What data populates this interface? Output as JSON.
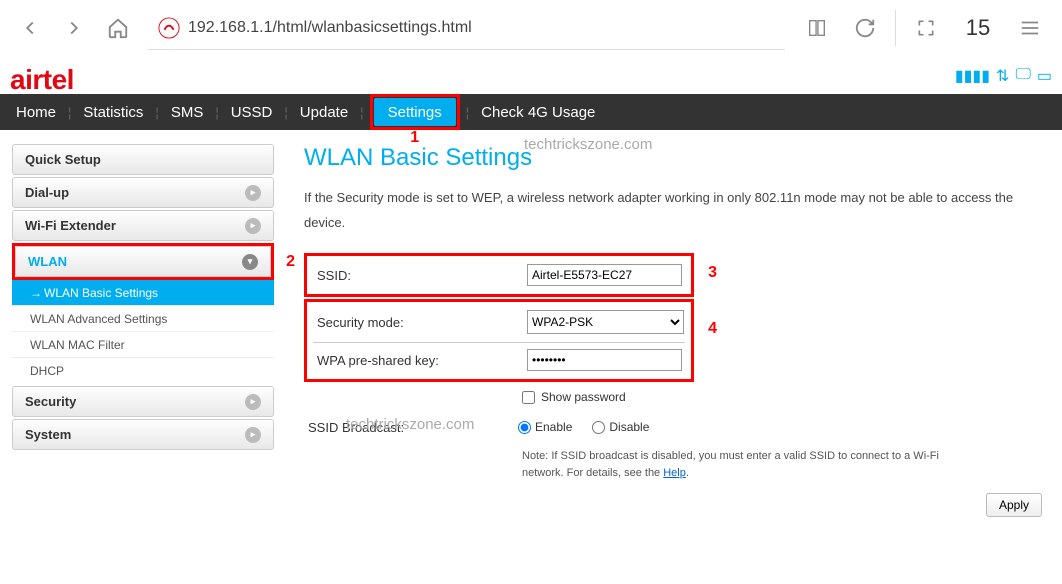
{
  "browser": {
    "url": "192.168.1.1/html/wlanbasicsettings.html",
    "tabs_count": "15"
  },
  "logo": "airtel",
  "nav": {
    "home": "Home",
    "statistics": "Statistics",
    "sms": "SMS",
    "ussd": "USSD",
    "update": "Update",
    "settings": "Settings",
    "check4g": "Check 4G Usage"
  },
  "markers": {
    "m1": "1",
    "m2": "2",
    "m3": "3",
    "m4": "4"
  },
  "sidebar": {
    "quick_setup": "Quick Setup",
    "dialup": "Dial-up",
    "wifi_extender": "Wi-Fi Extender",
    "wlan": "WLAN",
    "wlan_sub": {
      "basic": "WLAN Basic Settings",
      "advanced": "WLAN Advanced Settings",
      "mac": "WLAN MAC Filter",
      "dhcp": "DHCP"
    },
    "security": "Security",
    "system": "System"
  },
  "watermark": "techtrickszone.com",
  "main": {
    "title": "WLAN Basic Settings",
    "description": "If the Security mode is set to WEP, a wireless network adapter working in only 802.11n mode may not be able to access the device.",
    "ssid_label": "SSID:",
    "ssid_value": "Airtel-E5573-EC27",
    "secmode_label": "Security mode:",
    "secmode_value": "WPA2-PSK",
    "wpakey_label": "WPA pre-shared key:",
    "wpakey_value": "••••••••",
    "show_password": "Show password",
    "ssid_broadcast_label": "SSID Broadcast:",
    "enable": "Enable",
    "disable": "Disable",
    "note_prefix": "Note: If SSID broadcast is disabled, you must enter a valid SSID to connect to a Wi-Fi network. For details, see the ",
    "note_link": "Help",
    "note_suffix": ".",
    "apply": "Apply"
  }
}
